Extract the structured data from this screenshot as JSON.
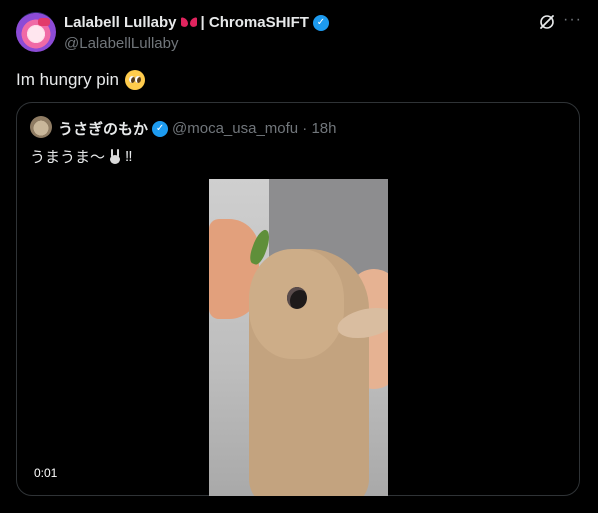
{
  "author": {
    "display_name": "Lalabell Lullaby",
    "name_suffix": "| ChromaSHIFT",
    "verified_mark": "✓",
    "handle": "@LalabellLullaby"
  },
  "header_actions": {
    "grok_icon": "grok-icon",
    "more_label": "···"
  },
  "tweet": {
    "text": "Im hungry pin"
  },
  "quoted_tweet": {
    "display_name": "うさぎのもか",
    "verified_mark": "✓",
    "meta": "@moca_usa_mofu · 18h",
    "text_prefix": "うまうま〜",
    "text_suffix": "‼",
    "video_time": "0:01"
  },
  "colors": {
    "background": "#000000",
    "text_primary": "#e7e9ea",
    "text_secondary": "#71767b",
    "verified": "#1d9bf0",
    "border": "#2f3336"
  }
}
